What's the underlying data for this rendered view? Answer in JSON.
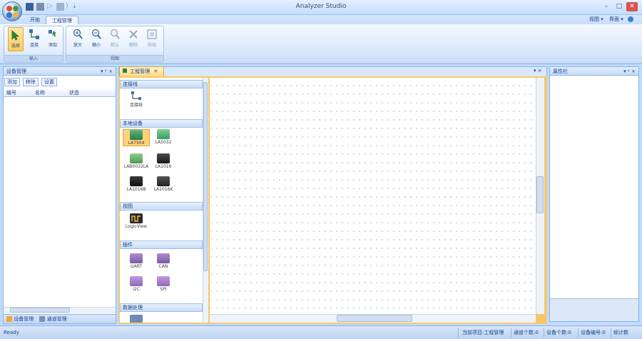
{
  "window": {
    "title": "Analyzer Studio",
    "top_right_links": [
      "视图 ▾",
      "界面 ▾"
    ],
    "controls": [
      "–",
      "□",
      "✕"
    ]
  },
  "ribbon": {
    "tabs": [
      "开始",
      "工程管理"
    ],
    "groups": [
      {
        "label": "输入",
        "buttons": [
          {
            "label": "选择",
            "icon": "pointer-icon",
            "active": true
          },
          {
            "label": "连接",
            "icon": "connect-icon",
            "active": false
          },
          {
            "label": "添加",
            "icon": "add-node-icon",
            "active": false
          }
        ]
      },
      {
        "label": "视图",
        "buttons": [
          {
            "label": "放大",
            "icon": "zoom-in-icon",
            "disabled": false
          },
          {
            "label": "缩小",
            "icon": "zoom-out-icon",
            "disabled": false
          },
          {
            "label": "默认",
            "icon": "zoom-default-icon",
            "disabled": true
          },
          {
            "label": "删除",
            "icon": "delete-icon",
            "disabled": true
          },
          {
            "label": "布局",
            "icon": "layout-icon",
            "disabled": true
          }
        ]
      }
    ]
  },
  "left_panel": {
    "title": "设备管理",
    "subtabs": [
      "添加",
      "移除",
      "设置"
    ],
    "columns": [
      "编号",
      "名称",
      "状态"
    ],
    "bottom_tabs": [
      "设备管理",
      "通道管理"
    ]
  },
  "document": {
    "tab_label": "工程管理",
    "toolbox": {
      "categories": [
        {
          "label": "连接线",
          "items": [
            {
              "label": "连接线",
              "icon": "connector-icon"
            }
          ]
        },
        {
          "label": "本地设备",
          "items": [
            {
              "label": "LA7504",
              "icon": "la7504-device-icon",
              "selected": true
            },
            {
              "label": "LA5032",
              "icon": "la5032-device-icon"
            },
            {
              "label": "LAB0032LA",
              "icon": "lab0032la-device-icon"
            },
            {
              "label": "LA1016",
              "icon": "la1016-device-icon"
            },
            {
              "label": "LA1016B",
              "icon": "la1016b-device-icon"
            },
            {
              "label": "LA1016K",
              "icon": "la1016k-device-icon"
            }
          ]
        },
        {
          "label": "视图",
          "items": [
            {
              "label": "LogicView",
              "icon": "logicview-icon"
            }
          ]
        },
        {
          "label": "插件",
          "items": [
            {
              "label": "UART",
              "icon": "uart-plugin-icon"
            },
            {
              "label": "CAN",
              "icon": "can-plugin-icon"
            },
            {
              "label": "I2C",
              "icon": "i2c-plugin-icon"
            },
            {
              "label": "SPI",
              "icon": "spi-plugin-icon"
            }
          ]
        },
        {
          "label": "数据处理",
          "items": []
        }
      ]
    }
  },
  "right_panel": {
    "title": "属性栏"
  },
  "status_bar": {
    "left": "Ready",
    "items": [
      "当前项目:工程管理",
      "通道个数:0",
      "设备个数:0",
      "设备编号:0",
      "帧计数"
    ]
  },
  "colors": {
    "ribbon_bg": "#dbe8fa",
    "frame_bg": "#bfdbff",
    "accent_active": "#ffcb5c",
    "canvas_bg": "#ffffff"
  }
}
